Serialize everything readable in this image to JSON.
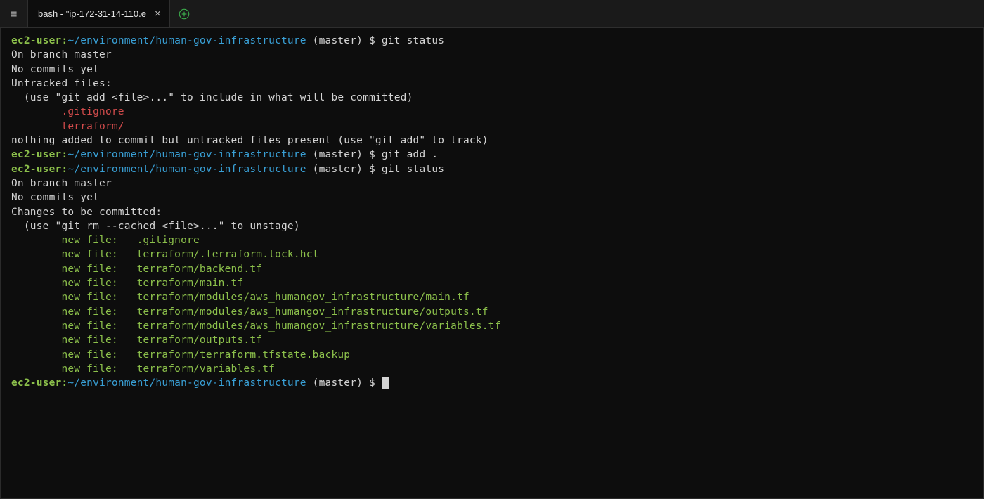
{
  "tab": {
    "title": "bash - \"ip-172-31-14-110.e"
  },
  "icons": {
    "menu": "≡",
    "close": "×",
    "plus_color": "#3fb950"
  },
  "prompt": {
    "user": "ec2-user:",
    "path": "~/environment/human-gov-infrastructure",
    "branch": "(master)",
    "sym": "$"
  },
  "lines": {
    "cmd1": "git status",
    "branch_line": "On branch master",
    "no_commits": "No commits yet",
    "untracked_header": "Untracked files:",
    "untracked_hint": "  (use \"git add <file>...\" to include in what will be committed)",
    "untracked_files": [
      "        .gitignore",
      "        terraform/"
    ],
    "nothing_added": "nothing added to commit but untracked files present (use \"git add\" to track)",
    "cmd2": "git add .",
    "cmd3": "git status",
    "changes_header": "Changes to be committed:",
    "changes_hint": "  (use \"git rm --cached <file>...\" to unstage)",
    "staged_files": [
      "        new file:   .gitignore",
      "        new file:   terraform/.terraform.lock.hcl",
      "        new file:   terraform/backend.tf",
      "        new file:   terraform/main.tf",
      "        new file:   terraform/modules/aws_humangov_infrastructure/main.tf",
      "        new file:   terraform/modules/aws_humangov_infrastructure/outputs.tf",
      "        new file:   terraform/modules/aws_humangov_infrastructure/variables.tf",
      "        new file:   terraform/outputs.tf",
      "        new file:   terraform/terraform.tfstate.backup",
      "        new file:   terraform/variables.tf"
    ]
  }
}
